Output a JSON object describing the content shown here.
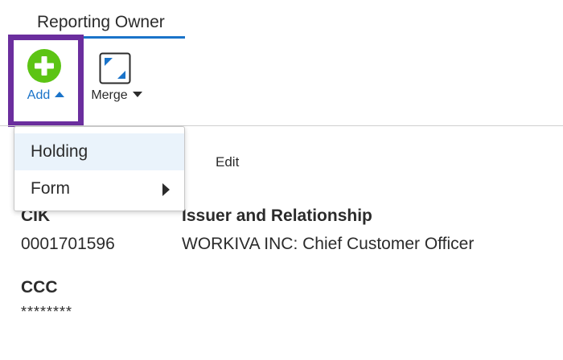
{
  "tab": {
    "label": "Reporting Owner"
  },
  "toolbar": {
    "add_label": "Add",
    "merge_label": "Merge"
  },
  "dropdown": {
    "items": [
      {
        "label": "Holding"
      },
      {
        "label": "Form"
      }
    ]
  },
  "edit_label": "Edit",
  "fields": {
    "cik": {
      "label": "CIK",
      "value": "0001701596"
    },
    "issuer": {
      "label": "Issuer and Relationship",
      "value": "WORKIVA INC: Chief Customer Officer"
    },
    "ccc": {
      "label": "CCC",
      "value": "********"
    }
  },
  "colors": {
    "accent_blue": "#1a73c9",
    "add_green": "#5cc414",
    "highlight_purple": "#6b2e9e"
  }
}
